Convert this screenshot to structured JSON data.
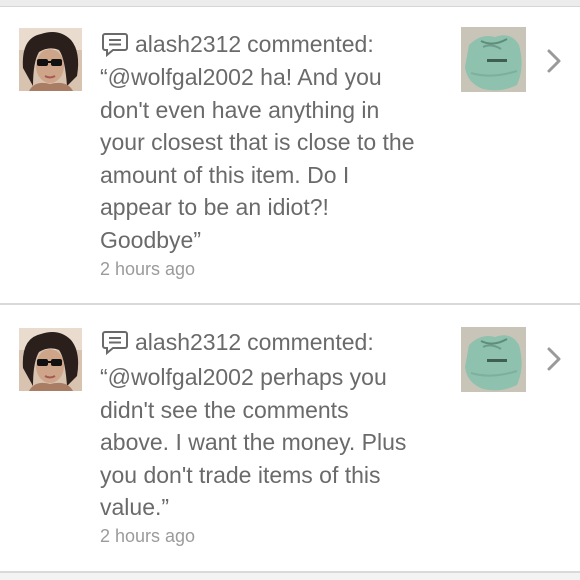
{
  "feed": {
    "items": [
      {
        "username": "alash2312",
        "action": "commented:",
        "comment_lines": [
          "“@wolfgal2002 ha! And you",
          "don't even have anything in",
          "your closest that is close to the",
          "amount of this item. Do I",
          "appear to be an idiot?!",
          "Goodbye”"
        ],
        "timestamp": "2 hours ago",
        "icons": {
          "comment": "comment-bubble-icon",
          "chevron": "chevron-right-icon"
        }
      },
      {
        "username": "alash2312",
        "action": "commented:",
        "comment_lines": [
          "“@wolfgal2002 perhaps you",
          "didn't see the comments",
          "above. I want the money. Plus",
          "you don't trade items of this",
          "value.”"
        ],
        "timestamp": "2 hours ago",
        "icons": {
          "comment": "comment-bubble-icon",
          "chevron": "chevron-right-icon"
        }
      }
    ],
    "colors": {
      "text": "#6a6a6a",
      "timestamp": "#9b9b9b",
      "divider": "#d9d9d9",
      "chevron": "#9a9a9a",
      "item_thumb": "#8fbfad"
    }
  }
}
